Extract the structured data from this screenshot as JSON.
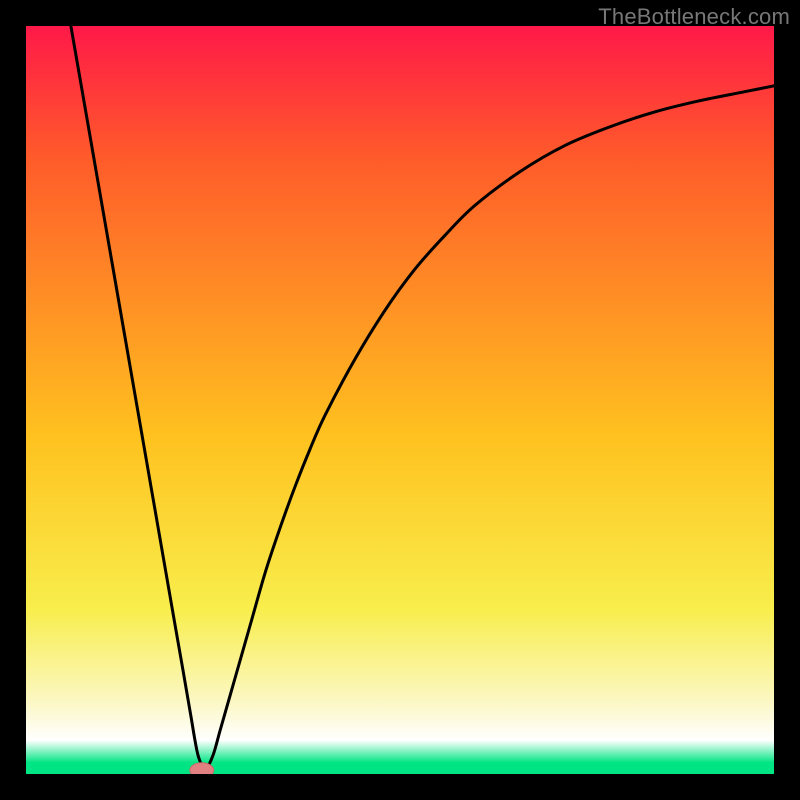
{
  "watermark": "TheBottleneck.com",
  "colors": {
    "frame": "#000000",
    "gradient_top": "#ff1948",
    "gradient_upper": "#ff5c2a",
    "gradient_mid": "#ffc21f",
    "gradient_low": "#f8ee4c",
    "gradient_pale": "#fbf7c0",
    "gradient_white": "#ffffff",
    "gradient_bottom": "#00e583",
    "curve": "#000000",
    "marker_fill": "#e08080",
    "marker_stroke": "#c96a6a"
  },
  "chart_data": {
    "type": "line",
    "title": "",
    "xlabel": "",
    "ylabel": "",
    "xlim": [
      0,
      100
    ],
    "ylim": [
      0,
      100
    ],
    "x": [
      6,
      8,
      10,
      12,
      14,
      16,
      18,
      20,
      21,
      22,
      23,
      24,
      25,
      26,
      28,
      30,
      32,
      34,
      36,
      38,
      40,
      44,
      48,
      52,
      56,
      60,
      66,
      72,
      78,
      84,
      90,
      96,
      100
    ],
    "values": [
      100,
      88.5,
      77,
      65.5,
      54,
      42.5,
      31,
      19.5,
      13.8,
      8,
      2.5,
      0.8,
      2.5,
      6,
      13,
      20,
      27,
      33,
      38.5,
      43.5,
      48,
      55.5,
      62,
      67.5,
      72,
      76,
      80.5,
      84,
      86.5,
      88.5,
      90,
      91.2,
      92
    ],
    "marker": {
      "x": 23.5,
      "y": 0.5,
      "rx": 1.6,
      "ry": 1.0
    },
    "grid": false,
    "legend": false
  }
}
